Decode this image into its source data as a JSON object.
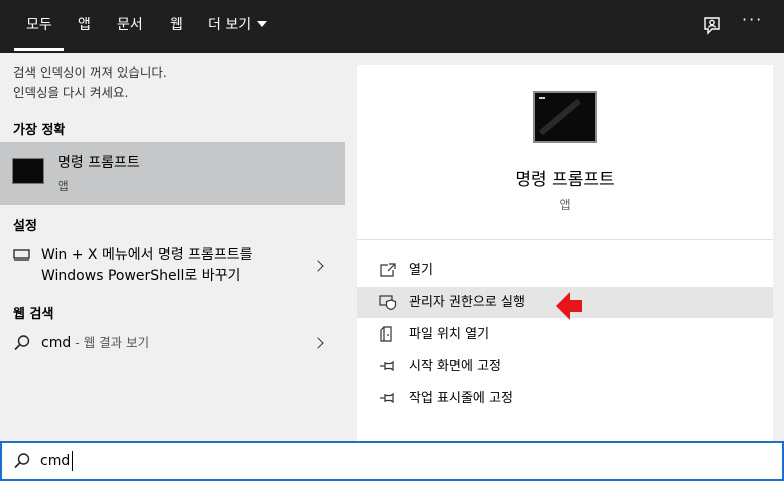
{
  "tabs": [
    {
      "label": "모두",
      "active": true
    },
    {
      "label": "앱"
    },
    {
      "label": "문서"
    },
    {
      "label": "웹"
    },
    {
      "label": "더 보기"
    }
  ],
  "top_icons": [
    "feedback-icon",
    "more-icon"
  ],
  "more_label": "···",
  "notice": {
    "line1": "검색 인덱싱이 꺼져 있습니다.",
    "line2": "인덱싱을 다시 켜세요."
  },
  "best_match": {
    "heading": "가장 정확",
    "title": "명령 프롬프트",
    "subtitle": "앱"
  },
  "settings": {
    "heading": "설정",
    "item_line1": "Win + X 메뉴에서 명령 프롬프트를",
    "item_line2": "Windows PowerShell로 바꾸기"
  },
  "web": {
    "heading": "웹 검색",
    "query": "cmd",
    "suffix": " - 웹 결과 보기"
  },
  "preview": {
    "title": "명령 프롬프트",
    "subtitle": "앱"
  },
  "actions": [
    {
      "label": "열기",
      "icon": "open-icon"
    },
    {
      "label": "관리자 권한으로 실행",
      "icon": "shield-icon",
      "highlighted": true
    },
    {
      "label": "파일 위치 열기",
      "icon": "file-location-icon"
    },
    {
      "label": "시작 화면에 고정",
      "icon": "pin-icon"
    },
    {
      "label": "작업 표시줄에 고정",
      "icon": "pin-icon"
    }
  ],
  "search": {
    "value": "cmd"
  },
  "colors": {
    "topbar": "#1f1f1f",
    "selected_row": "#c6c7c8",
    "accent_border": "#1e6fcc",
    "arrow": "#e8141c"
  }
}
